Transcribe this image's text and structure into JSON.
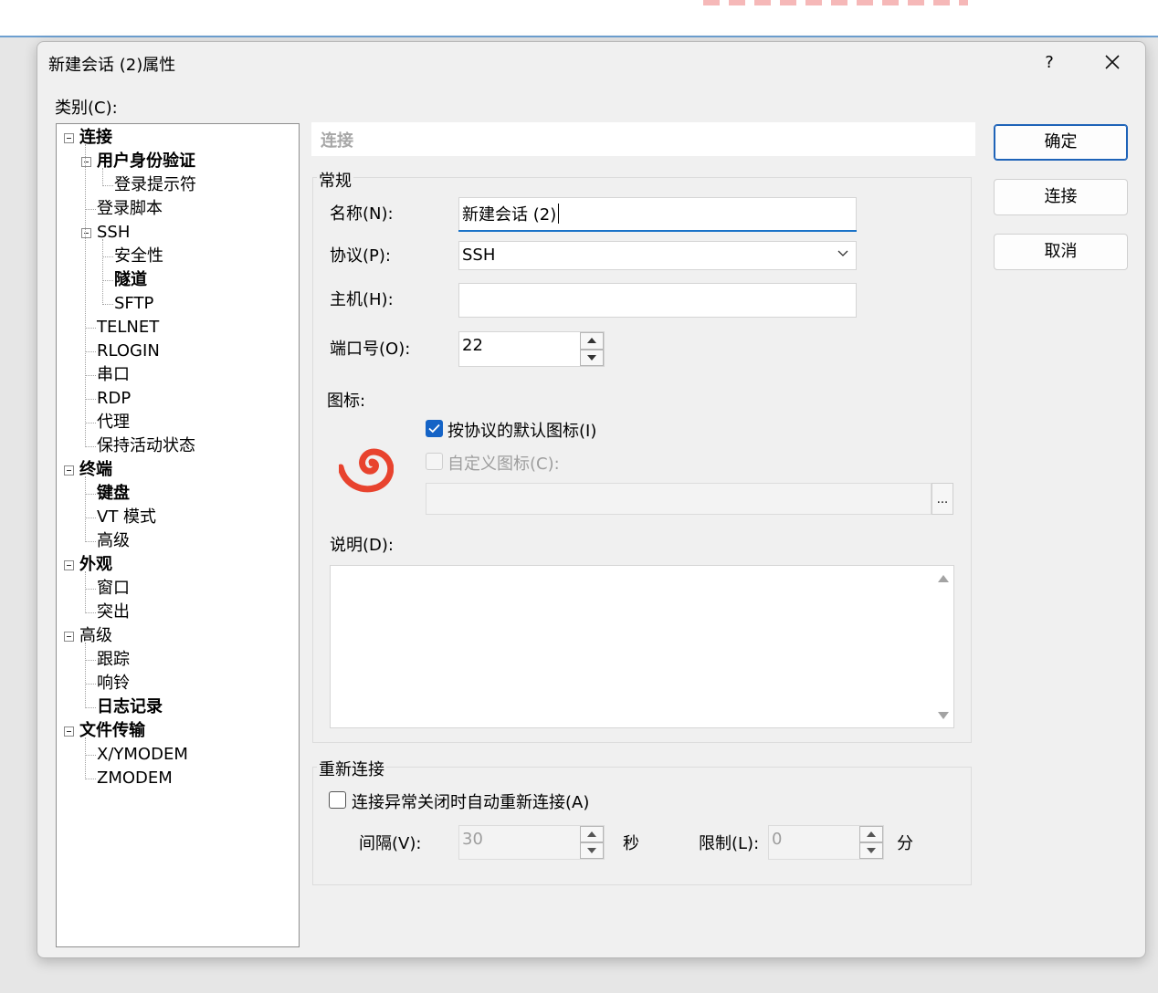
{
  "dialog": {
    "title": "新建会话 (2)属性",
    "help_label": "?"
  },
  "category_label": "类别(C):",
  "tree": [
    {
      "label": "连接",
      "bold": true
    },
    {
      "label": "用户身份验证",
      "bold": true
    },
    {
      "label": "登录提示符",
      "bold": false
    },
    {
      "label": "登录脚本",
      "bold": false
    },
    {
      "label": "SSH",
      "bold": false
    },
    {
      "label": "安全性",
      "bold": false
    },
    {
      "label": "隧道",
      "bold": true
    },
    {
      "label": "SFTP",
      "bold": false
    },
    {
      "label": "TELNET",
      "bold": false
    },
    {
      "label": "RLOGIN",
      "bold": false
    },
    {
      "label": "串口",
      "bold": false
    },
    {
      "label": "RDP",
      "bold": false
    },
    {
      "label": "代理",
      "bold": false
    },
    {
      "label": "保持活动状态",
      "bold": false
    },
    {
      "label": "终端",
      "bold": true
    },
    {
      "label": "键盘",
      "bold": true
    },
    {
      "label": "VT 模式",
      "bold": false
    },
    {
      "label": "高级",
      "bold": false
    },
    {
      "label": "外观",
      "bold": true
    },
    {
      "label": "窗口",
      "bold": false
    },
    {
      "label": "突出",
      "bold": false
    },
    {
      "label": "高级",
      "bold": false
    },
    {
      "label": "跟踪",
      "bold": false
    },
    {
      "label": "响铃",
      "bold": false
    },
    {
      "label": "日志记录",
      "bold": true
    },
    {
      "label": "文件传输",
      "bold": true
    },
    {
      "label": "X/YMODEM",
      "bold": false
    },
    {
      "label": "ZMODEM",
      "bold": false
    }
  ],
  "panel_header": "连接",
  "general": {
    "title": "常规",
    "name_label": "名称(N):",
    "name_value": "新建会话 (2)",
    "protocol_label": "协议(P):",
    "protocol_value": "SSH",
    "host_label": "主机(H):",
    "host_value": "",
    "port_label": "端口号(O):",
    "port_value": "22",
    "icon_label": "图标:",
    "default_icon_label": "按协议的默认图标(I)",
    "default_icon_checked": true,
    "custom_icon_label": "自定义图标(C):",
    "custom_icon_checked": false,
    "browse_label": "...",
    "desc_label": "说明(D):",
    "desc_value": ""
  },
  "reconnect": {
    "title": "重新连接",
    "auto_label": "连接异常关闭时自动重新连接(A)",
    "auto_checked": false,
    "interval_label": "间隔(V):",
    "interval_value": "30",
    "interval_unit": "秒",
    "limit_label": "限制(L):",
    "limit_value": "0",
    "limit_unit": "分"
  },
  "buttons": {
    "ok": "确定",
    "connect": "连接",
    "cancel": "取消"
  },
  "colors": {
    "accent": "#1463c6",
    "icon_red": "#e8432e",
    "dialog_bg": "#f0f0f0"
  },
  "icons": {
    "protocol_icon": "ssh-swirl-icon"
  }
}
